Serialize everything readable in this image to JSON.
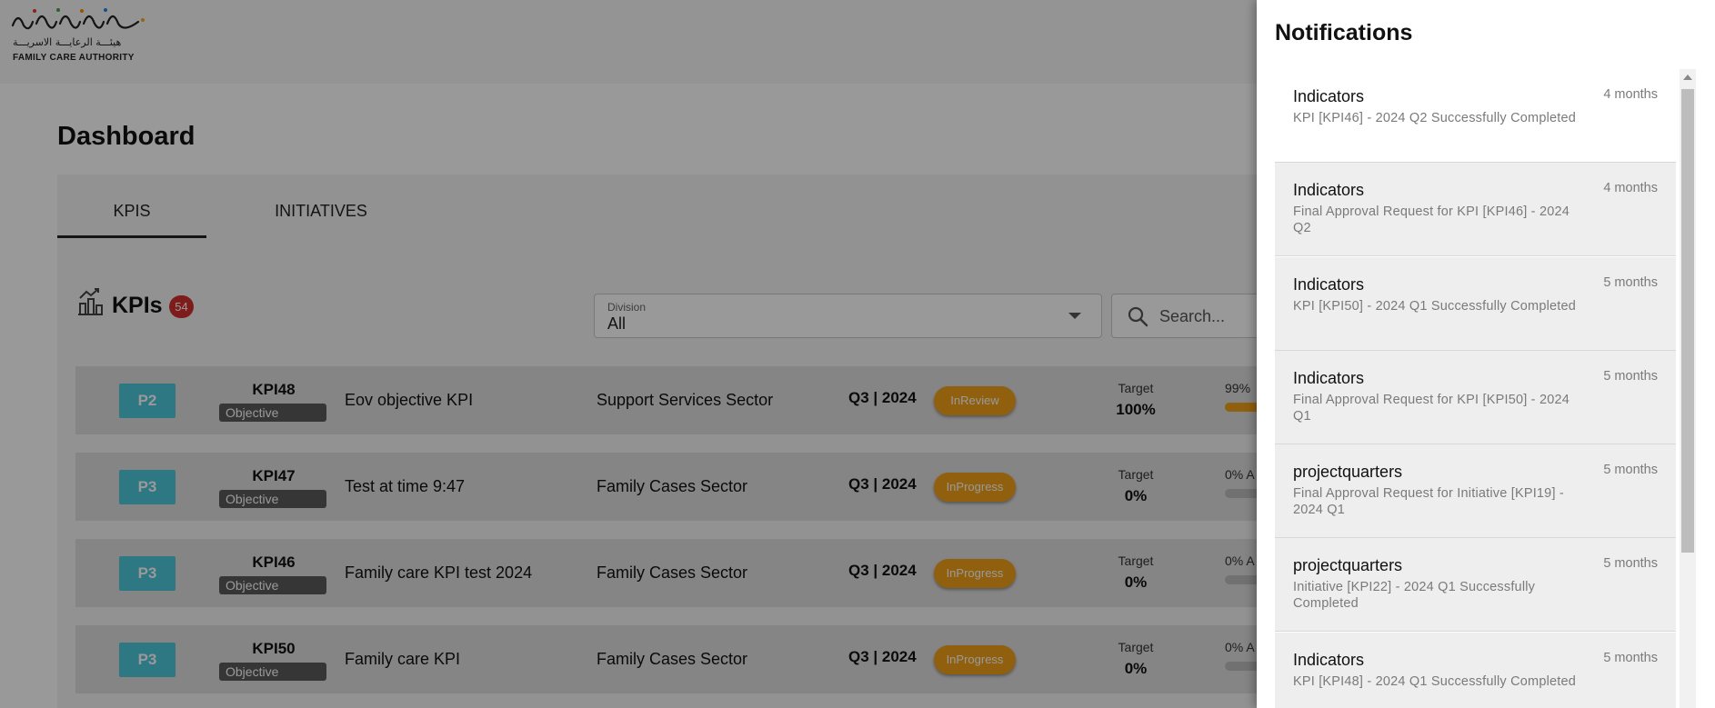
{
  "logo": {
    "arabic": "هيئـــة الرعايـــة الاسريـــة",
    "english": "FAMILY CARE AUTHORITY"
  },
  "page": {
    "title": "Dashboard"
  },
  "tabs": [
    {
      "label": "KPIS",
      "active": true
    },
    {
      "label": "INITIATIVES",
      "active": false
    }
  ],
  "kpis": {
    "title": "KPIs",
    "count": "54",
    "icon": "chart-growth-icon"
  },
  "filters": {
    "division_label": "Division",
    "division_value": "All",
    "search_placeholder": "Search..."
  },
  "rows": [
    {
      "priority": "P2",
      "id": "KPI48",
      "type": "Objective",
      "name": "Eov objective KPI",
      "sector": "Support Services Sector",
      "period": "Q3 | 2024",
      "status": "InReview",
      "target_label": "Target",
      "target": "100%",
      "progress_text": "99%",
      "progress": 0.99
    },
    {
      "priority": "P3",
      "id": "KPI47",
      "type": "Objective",
      "name": "Test at time 9:47",
      "sector": "Family Cases Sector",
      "period": "Q3 | 2024",
      "status": "InProgress",
      "target_label": "Target",
      "target": "0%",
      "progress_text": "0% A",
      "progress": 0
    },
    {
      "priority": "P3",
      "id": "KPI46",
      "type": "Objective",
      "name": "Family care KPI test 2024",
      "sector": "Family Cases Sector",
      "period": "Q3 | 2024",
      "status": "InProgress",
      "target_label": "Target",
      "target": "0%",
      "progress_text": "0% A",
      "progress": 0
    },
    {
      "priority": "P3",
      "id": "KPI50",
      "type": "Objective",
      "name": "Family care KPI",
      "sector": "Family Cases Sector",
      "period": "Q3 | 2024",
      "status": "InProgress",
      "target_label": "Target",
      "target": "0%",
      "progress_text": "0% A",
      "progress": 0
    }
  ],
  "notifications": {
    "title": "Notifications",
    "items": [
      {
        "title": "Indicators",
        "text": "KPI [KPI46] - 2024 Q2 Successfully Completed",
        "time": "4 months",
        "read": true
      },
      {
        "title": "Indicators",
        "text": "Final Approval Request for KPI [KPI46] - 2024 Q2",
        "time": "4 months",
        "read": false
      },
      {
        "title": "Indicators",
        "text": "KPI [KPI50] - 2024 Q1 Successfully Completed",
        "time": "5 months",
        "read": false
      },
      {
        "title": "Indicators",
        "text": "Final Approval Request for KPI [KPI50] - 2024 Q1",
        "time": "5 months",
        "read": false
      },
      {
        "title": "projectquarters",
        "text": "Final Approval Request for Initiative [KPI19] - 2024 Q1",
        "time": "5 months",
        "read": false
      },
      {
        "title": "projectquarters",
        "text": "Initiative [KPI22] - 2024 Q1 Successfully Completed",
        "time": "5 months",
        "read": false
      },
      {
        "title": "Indicators",
        "text": "KPI [KPI48] - 2024 Q1 Successfully Completed",
        "time": "5 months",
        "read": false
      }
    ]
  },
  "colors": {
    "priority": "#4bc9db",
    "status": "#f0a018",
    "count_badge": "#d32f2f",
    "type_badge": "#5b5b5b"
  }
}
